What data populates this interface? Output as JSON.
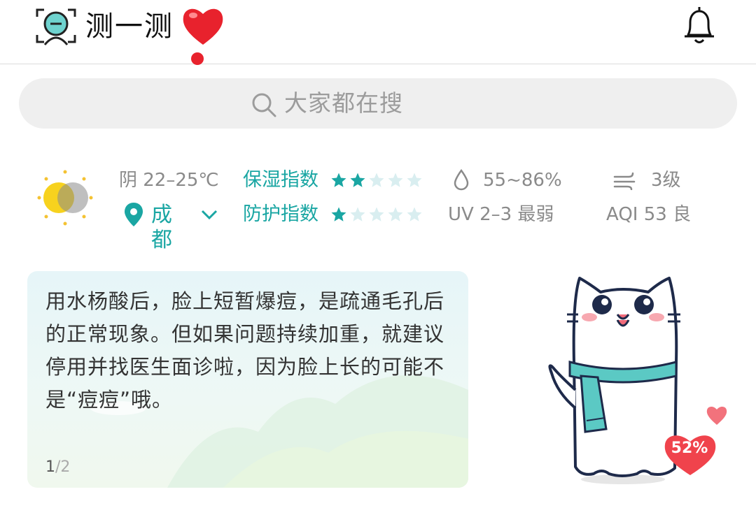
{
  "header": {
    "title": "测一测",
    "logo_icon": "face-scan-icon",
    "heart_icon": "heart-exclamation-icon",
    "notification_icon": "bell-icon"
  },
  "search": {
    "placeholder": "大家都在搜"
  },
  "weather": {
    "icon": "sun-cloud-icon",
    "condition_temp": "阴 22–25℃",
    "city": "成都",
    "moisture_label": "保湿指数",
    "moisture_stars": 2,
    "protection_label": "防护指数",
    "protection_stars": 1,
    "max_stars": 5,
    "humidity": "55~86%",
    "uv": "UV  2–3 最弱",
    "wind": "3级",
    "aqi": "AQI  53 良"
  },
  "tip": {
    "text": "用水杨酸后，脸上短暂爆痘，是疏通毛孔后的正常现象。但如果问题持续加重，就建议停用并找医生面诊啦，因为脸上长的可能不是“痘痘”哦。",
    "page_current": "1",
    "page_total": "/2"
  },
  "mascot": {
    "mood_percent": "52%"
  },
  "colors": {
    "accent": "#1aa6a3",
    "star_off": "#d9eef0",
    "heart": "#f0434c"
  }
}
